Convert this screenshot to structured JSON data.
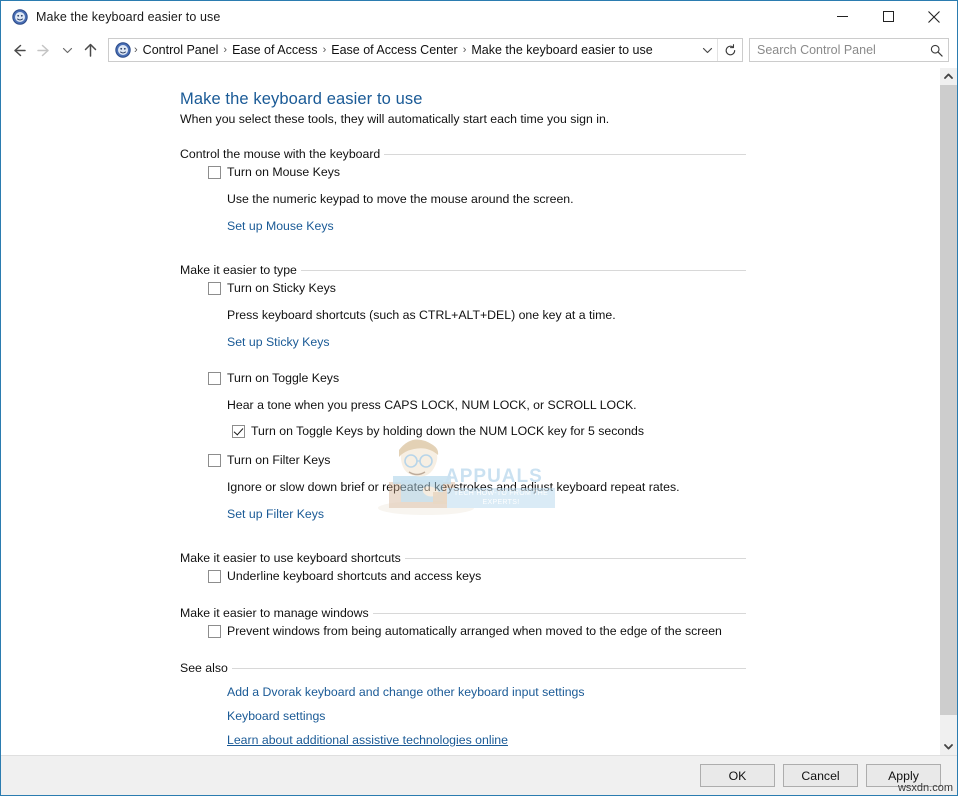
{
  "window": {
    "title": "Make the keyboard easier to use",
    "app_icon": "ease-of-access-icon",
    "controls": {
      "minimize": "minimize-icon",
      "maximize": "maximize-icon",
      "close": "close-icon"
    }
  },
  "navbar": {
    "back": "back-arrow-icon",
    "forward": "forward-arrow-icon",
    "recent": "chevron-down-icon",
    "up": "up-arrow-icon",
    "breadcrumb": [
      "Control Panel",
      "Ease of Access",
      "Ease of Access Center",
      "Make the keyboard easier to use"
    ],
    "separator": "›",
    "dropdown": "chevron-down-icon",
    "refresh": "refresh-icon",
    "search": {
      "placeholder": "Search Control Panel",
      "value": "",
      "icon": "search-icon"
    }
  },
  "page": {
    "title": "Make the keyboard easier to use",
    "subtitle": "When you select these tools, they will automatically start each time you sign in."
  },
  "groups": {
    "mouse_keys": {
      "header": "Control the mouse with the keyboard",
      "checkbox_label": "Turn on Mouse Keys",
      "checked": false,
      "description": "Use the numeric keypad to move the mouse around the screen.",
      "link": "Set up Mouse Keys"
    },
    "easier_to_type": {
      "header": "Make it easier to type",
      "sticky": {
        "checkbox_label": "Turn on Sticky Keys",
        "checked": false,
        "description": "Press keyboard shortcuts (such as CTRL+ALT+DEL) one key at a time.",
        "link": "Set up Sticky Keys"
      },
      "toggle": {
        "checkbox_label": "Turn on Toggle Keys",
        "checked": false,
        "description": "Hear a tone when you press CAPS LOCK, NUM LOCK, or SCROLL LOCK.",
        "sub_checkbox_label": "Turn on Toggle Keys by holding down the NUM LOCK key for 5 seconds",
        "sub_checked": true
      },
      "filter": {
        "checkbox_label": "Turn on Filter Keys",
        "checked": false,
        "description": "Ignore or slow down brief or repeated keystrokes and adjust keyboard repeat rates.",
        "link": "Set up Filter Keys"
      }
    },
    "shortcuts": {
      "header": "Make it easier to use keyboard shortcuts",
      "checkbox_label": "Underline keyboard shortcuts and access keys",
      "checked": false
    },
    "manage_windows": {
      "header": "Make it easier to manage windows",
      "checkbox_label": "Prevent windows from being automatically arranged when moved to the edge of the screen",
      "checked": false
    },
    "see_also": {
      "header": "See also",
      "links": [
        "Add a Dvorak keyboard and change other keyboard input settings",
        "Keyboard settings",
        "Learn about additional assistive technologies online"
      ]
    }
  },
  "buttons": {
    "ok": "OK",
    "cancel": "Cancel",
    "apply": "Apply"
  },
  "watermark": {
    "brand": "APPUALS",
    "tagline": "TECH HOW-TO FROM THE EXPERTS!",
    "site": "wsxdn.com"
  },
  "scrollbar": {
    "up_arrow": "chevron-up-icon",
    "down_arrow": "chevron-down-icon"
  },
  "colors": {
    "accent_link": "#1a5a96",
    "window_border": "#2b7cb0",
    "chrome_bg": "#f0f0f0"
  }
}
